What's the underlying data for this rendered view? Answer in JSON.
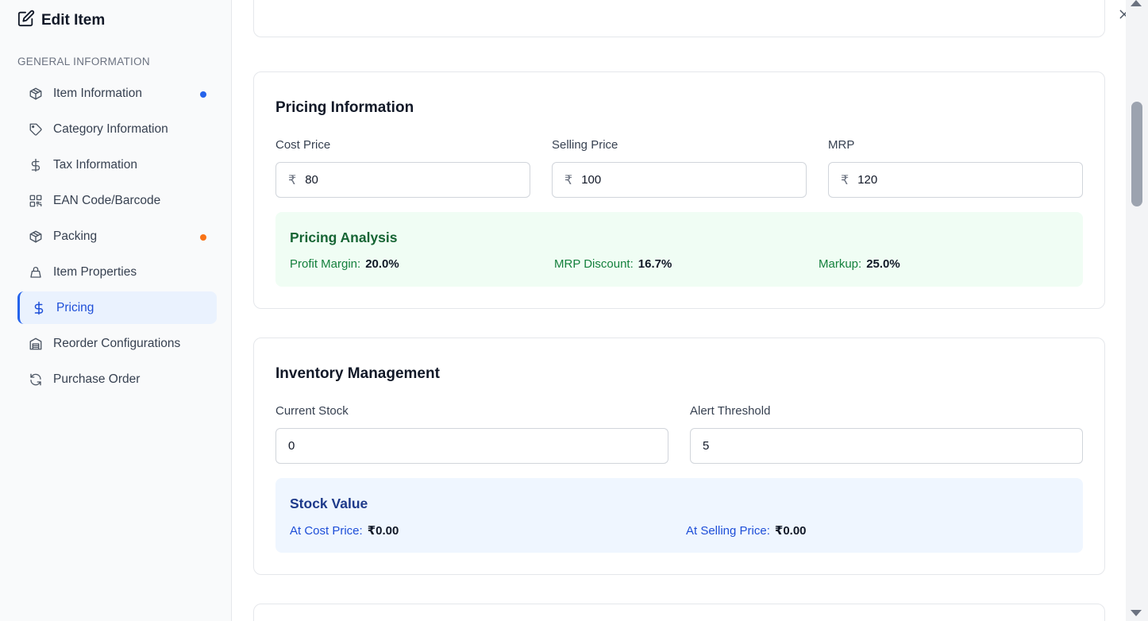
{
  "header": {
    "title": "Edit Item"
  },
  "sidebar": {
    "section_label": "GENERAL INFORMATION",
    "items": [
      {
        "label": "Item Information",
        "icon": "box-icon",
        "dot": "#2563eb"
      },
      {
        "label": "Category Information",
        "icon": "tag-icon"
      },
      {
        "label": "Tax Information",
        "icon": "dollar-icon"
      },
      {
        "label": "EAN Code/Barcode",
        "icon": "qr-code-icon"
      },
      {
        "label": "Packing",
        "icon": "box-icon",
        "dot": "#f97316"
      },
      {
        "label": "Item Properties",
        "icon": "bag-icon"
      },
      {
        "label": "Pricing",
        "icon": "dollar-icon",
        "active": true
      },
      {
        "label": "Reorder Configurations",
        "icon": "warehouse-icon"
      },
      {
        "label": "Purchase Order",
        "icon": "refresh-icon"
      }
    ]
  },
  "pricing": {
    "title": "Pricing Information",
    "currency_symbol": "₹",
    "cost_price": {
      "label": "Cost Price",
      "value": "80"
    },
    "selling_price": {
      "label": "Selling Price",
      "value": "100"
    },
    "mrp": {
      "label": "MRP",
      "value": "120"
    },
    "analysis": {
      "title": "Pricing Analysis",
      "profit_margin_label": "Profit Margin:",
      "profit_margin_value": "20.0%",
      "mrp_discount_label": "MRP Discount:",
      "mrp_discount_value": "16.7%",
      "markup_label": "Markup:",
      "markup_value": "25.0%"
    }
  },
  "inventory": {
    "title": "Inventory Management",
    "current_stock": {
      "label": "Current Stock",
      "value": "0"
    },
    "alert_threshold": {
      "label": "Alert Threshold",
      "value": "5"
    },
    "stock_value": {
      "title": "Stock Value",
      "at_cost_label": "At Cost Price:",
      "at_cost_value": "₹0.00",
      "at_selling_label": "At Selling Price:",
      "at_selling_value": "₹0.00"
    }
  },
  "colors": {
    "accent": "#2563eb",
    "success_bg": "#f0fdf4",
    "info_bg": "#eff6ff",
    "dot_blue": "#2563eb",
    "dot_orange": "#f97316"
  }
}
